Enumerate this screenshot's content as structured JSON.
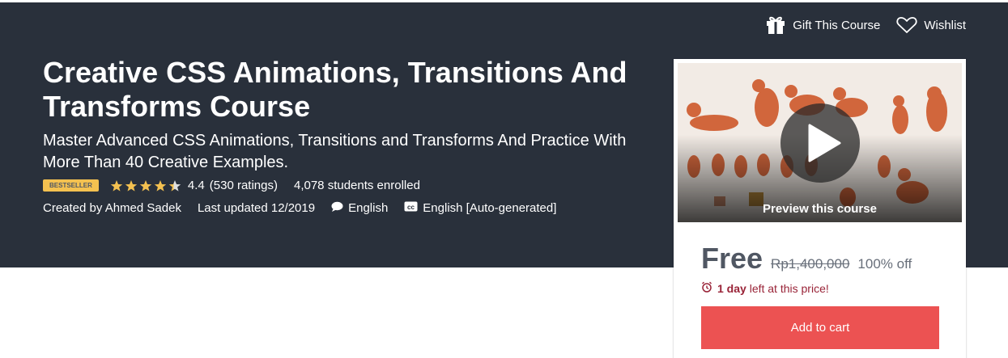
{
  "header": {
    "gift_label": "Gift This Course",
    "wishlist_label": "Wishlist"
  },
  "course": {
    "title": "Creative CSS Animations, Transitions And Transforms Course",
    "subtitle": "Master Advanced CSS Animations, Transitions and Transforms And Practice With More Than 40 Creative Examples.",
    "badge": "Bestseller",
    "rating": "4.4",
    "rating_value": 4.4,
    "ratings_count": "(530 ratings)",
    "enrolled": "4,078 students enrolled",
    "created_by": "Created by Ahmed Sadek",
    "last_updated": "Last updated 12/2019",
    "language": "English",
    "captions": "English [Auto-generated]"
  },
  "sidebar": {
    "preview_label": "Preview this course",
    "price": "Free",
    "original_price": "Rp1,400,000",
    "discount": "100% off",
    "timer_bold": "1 day",
    "timer_rest": "left at this price!",
    "add_to_cart": "Add to cart"
  },
  "colors": {
    "hero_bg": "#29303b",
    "badge": "#f4c150",
    "star": "#f4c150",
    "cta": "#ec5252",
    "timer": "#992337"
  },
  "icons": {
    "gift": "gift-icon",
    "wishlist": "heart-icon",
    "language": "speech-bubble-icon",
    "captions": "closed-captions-icon",
    "timer": "alarm-clock-icon",
    "play": "play-icon"
  }
}
